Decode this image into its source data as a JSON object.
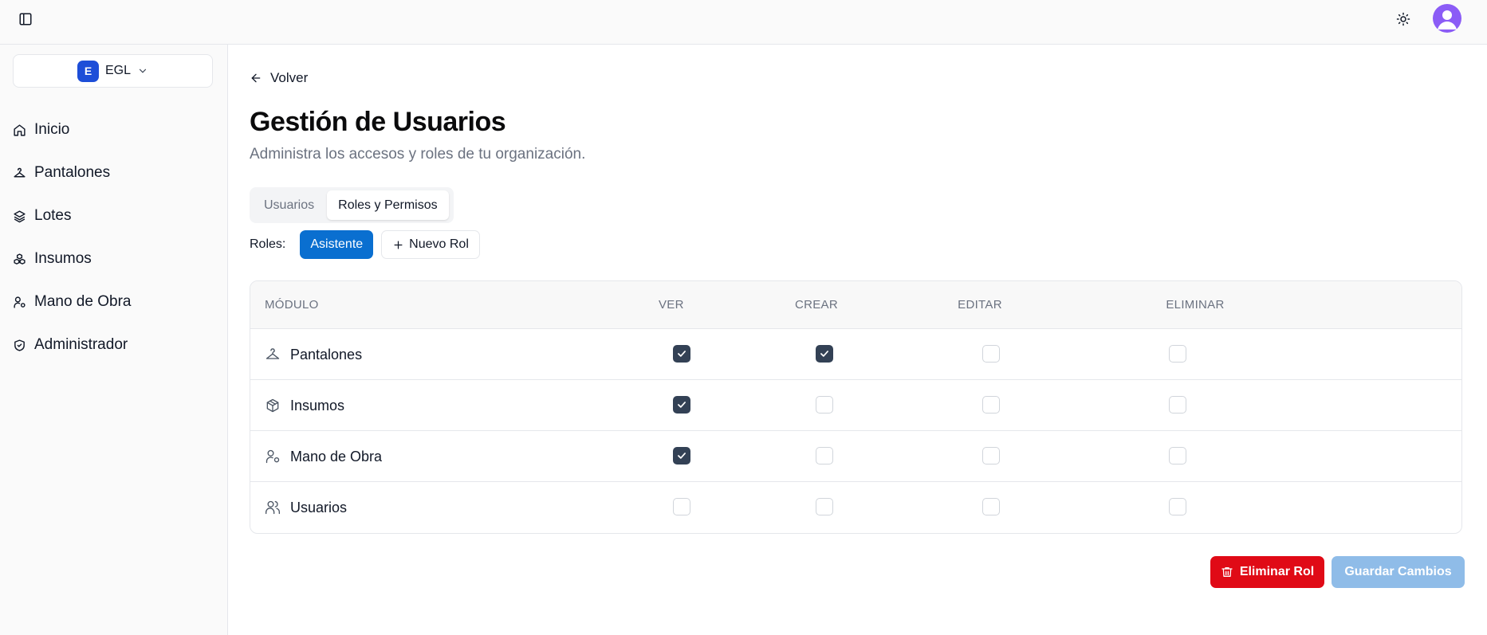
{
  "org": {
    "initial": "E",
    "name": "EGL"
  },
  "sidebar": {
    "items": [
      {
        "label": "Inicio",
        "icon": "home-icon"
      },
      {
        "label": "Pantalones",
        "icon": "hanger-icon"
      },
      {
        "label": "Lotes",
        "icon": "layers-icon"
      },
      {
        "label": "Insumos",
        "icon": "boxes-icon"
      },
      {
        "label": "Mano de Obra",
        "icon": "user-cog-icon"
      },
      {
        "label": "Administrador",
        "icon": "shield-check-icon"
      }
    ]
  },
  "page": {
    "back_label": "Volver",
    "title": "Gestión de Usuarios",
    "subtitle": "Administra los accesos y roles de tu organización."
  },
  "tabs": [
    {
      "label": "Usuarios",
      "active": false
    },
    {
      "label": "Roles y Permisos",
      "active": true
    }
  ],
  "roles": {
    "label": "Roles:",
    "selected": "Asistente",
    "new_label": "Nuevo Rol"
  },
  "table": {
    "headers": [
      "MÓDULO",
      "VER",
      "CREAR",
      "EDITAR",
      "ELIMINAR"
    ],
    "rows": [
      {
        "module": "Pantalones",
        "icon": "hanger-icon",
        "ver": true,
        "crear": true,
        "editar": false,
        "eliminar": false
      },
      {
        "module": "Insumos",
        "icon": "package-icon",
        "ver": true,
        "crear": false,
        "editar": false,
        "eliminar": false
      },
      {
        "module": "Mano de Obra",
        "icon": "user-cog-icon",
        "ver": true,
        "crear": false,
        "editar": false,
        "eliminar": false
      },
      {
        "module": "Usuarios",
        "icon": "users-icon",
        "ver": false,
        "crear": false,
        "editar": false,
        "eliminar": false
      }
    ]
  },
  "actions": {
    "delete_label": "Eliminar Rol",
    "save_label": "Guardar Cambios"
  },
  "colors": {
    "primary": "#0a6fd0",
    "danger": "#e00a16",
    "checkbox_checked": "#334155",
    "avatar": "#8b5cf6"
  }
}
